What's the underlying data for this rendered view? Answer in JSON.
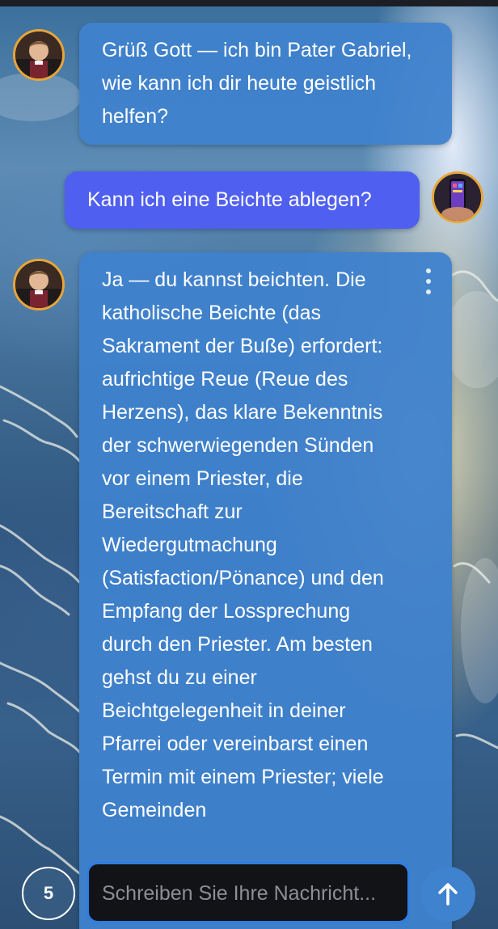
{
  "chat": {
    "messages": [
      {
        "role": "assistant",
        "sender": "Pater Gabriel",
        "avatar": "priest-avatar",
        "text": "Grüß Gott — ich bin Pater Gabriel, wie kann ich dir heute geistlich helfen?"
      },
      {
        "role": "user",
        "avatar": "user-phone-avatar",
        "text": "Kann ich eine Beichte ablegen?"
      },
      {
        "role": "assistant",
        "sender": "Pater Gabriel",
        "avatar": "priest-avatar",
        "text": "Ja — du kannst beichten. Die katholische Beichte (das Sakrament der Buße) erfordert: aufrichtige Reue (Reue des Herzens), das klare Bekenntnis der schwerwiegenden Sünden vor einem Priester, die Bereitschaft zur Wiedergutmachung (Satisfaction/Pönance) und den Empfang der Lossprechung durch den Priester. Am besten gehst du zu einer Beichtgelegenheit in deiner Pfarrei oder vereinbarst einen Termin mit einem Priester; viele Gemeinden",
        "menu_icon": "more-vertical-icon"
      }
    ]
  },
  "composer": {
    "counter": "5",
    "placeholder": "Schreiben Sie Ihre Nachricht...",
    "value": "",
    "send_icon": "arrow-up-icon"
  },
  "colors": {
    "assistant_bubble": "#3F82CE",
    "user_bubble": "#4F5FF0",
    "avatar_border": "#E7A53A",
    "input_border": "#2F7DE3",
    "input_background": "#121316",
    "send_button": "#3F82CE"
  }
}
